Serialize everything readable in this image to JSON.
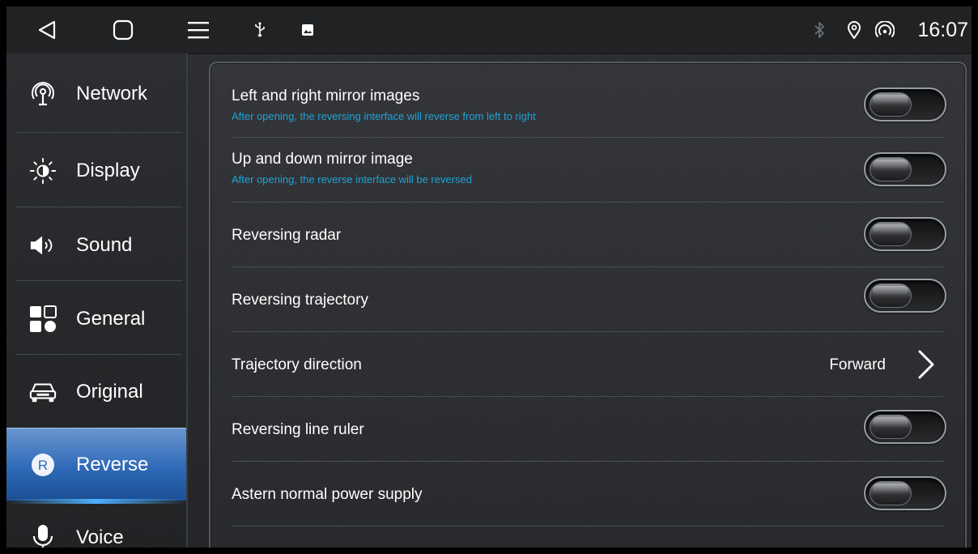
{
  "statusbar": {
    "back_icon": "back-triangle-icon",
    "home_icon": "home-square-icon",
    "menu_icon": "hamburger-menu-icon",
    "usb_icon": "usb-icon",
    "image_icon": "image-notification-icon",
    "bluetooth_icon": "bluetooth-icon",
    "location_icon": "location-pin-icon",
    "hotspot_icon": "hotspot-icon",
    "time": "16:07"
  },
  "sidebar": {
    "items": [
      {
        "label": "Network",
        "icon": "network-icon"
      },
      {
        "label": "Display",
        "icon": "brightness-icon"
      },
      {
        "label": "Sound",
        "icon": "speaker-icon"
      },
      {
        "label": "General",
        "icon": "general-grid-icon"
      },
      {
        "label": "Original",
        "icon": "car-icon"
      },
      {
        "label": "Reverse",
        "icon": "reverse-r-icon",
        "active": true
      },
      {
        "label": "Voice",
        "icon": "microphone-icon"
      }
    ]
  },
  "settings": {
    "rows": [
      {
        "title": "Left and right mirror images",
        "subtitle": "After opening, the reversing interface will reverse from left to right",
        "control": "toggle",
        "state": "off"
      },
      {
        "title": "Up and down mirror image",
        "subtitle": "After opening, the reverse interface will be reversed",
        "control": "toggle",
        "state": "off"
      },
      {
        "title": "Reversing radar",
        "control": "toggle",
        "state": "off"
      },
      {
        "title": "Reversing trajectory",
        "control": "toggle",
        "state": "off"
      },
      {
        "title": "Trajectory direction",
        "control": "select",
        "value": "Forward"
      },
      {
        "title": "Reversing line ruler",
        "control": "toggle",
        "state": "off"
      },
      {
        "title": "Astern normal power supply",
        "control": "toggle",
        "state": "off"
      }
    ]
  },
  "colors": {
    "accent_blue": "#2e6ab8",
    "subtitle_cyan": "#1ea3d8"
  }
}
